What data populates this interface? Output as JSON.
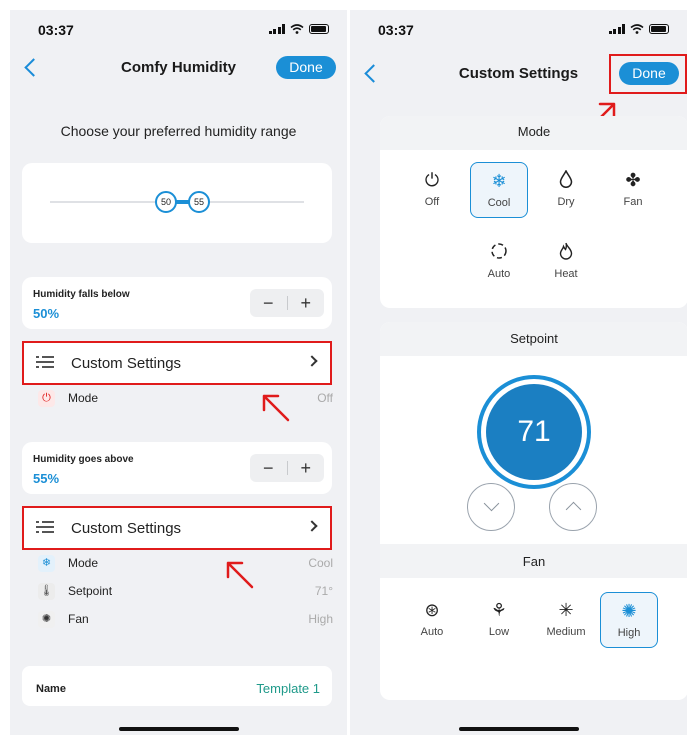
{
  "left": {
    "status_time": "03:37",
    "nav_title": "Comfy Humidity",
    "done_label": "Done",
    "range_heading": "Choose your preferred humidity range",
    "slider": {
      "low": "50",
      "high": "55"
    },
    "below": {
      "label": "Humidity falls below",
      "value": "50%",
      "minus": "−",
      "plus": "+",
      "custom_label": "Custom Settings",
      "items": [
        {
          "label": "Mode",
          "value": "Off",
          "icon": "power-icon"
        }
      ]
    },
    "above": {
      "label": "Humidity goes above",
      "value": "55%",
      "minus": "−",
      "plus": "+",
      "custom_label": "Custom Settings",
      "items": [
        {
          "label": "Mode",
          "value": "Cool",
          "icon": "snowflake-icon"
        },
        {
          "label": "Setpoint",
          "value": "71°",
          "icon": "thermometer-icon"
        },
        {
          "label": "Fan",
          "value": "High",
          "icon": "fan-icon"
        }
      ]
    },
    "name": {
      "label": "Name",
      "value": "Template 1"
    }
  },
  "right": {
    "status_time": "03:37",
    "nav_title": "Custom Settings",
    "done_label": "Done",
    "mode_title": "Mode",
    "modes": [
      {
        "label": "Off",
        "icon": "power-icon",
        "selected": false
      },
      {
        "label": "Cool",
        "icon": "snowflake-icon",
        "selected": true
      },
      {
        "label": "Dry",
        "icon": "droplet-icon",
        "selected": false
      },
      {
        "label": "Fan",
        "icon": "fan-icon",
        "selected": false
      },
      {
        "label": "Auto",
        "icon": "auto-icon",
        "selected": false
      },
      {
        "label": "Heat",
        "icon": "flame-icon",
        "selected": false
      }
    ],
    "setpoint_title": "Setpoint",
    "setpoint_value": "71",
    "fan_title": "Fan",
    "fans": [
      {
        "label": "Auto",
        "icon": "fan-auto-icon",
        "selected": false
      },
      {
        "label": "Low",
        "icon": "fan-low-icon",
        "selected": false
      },
      {
        "label": "Medium",
        "icon": "fan-medium-icon",
        "selected": false
      },
      {
        "label": "High",
        "icon": "fan-high-icon",
        "selected": true
      }
    ]
  },
  "colors": {
    "accent": "#1b8fd6",
    "highlight": "#e01b1b",
    "name_value": "#1f9a8a"
  }
}
